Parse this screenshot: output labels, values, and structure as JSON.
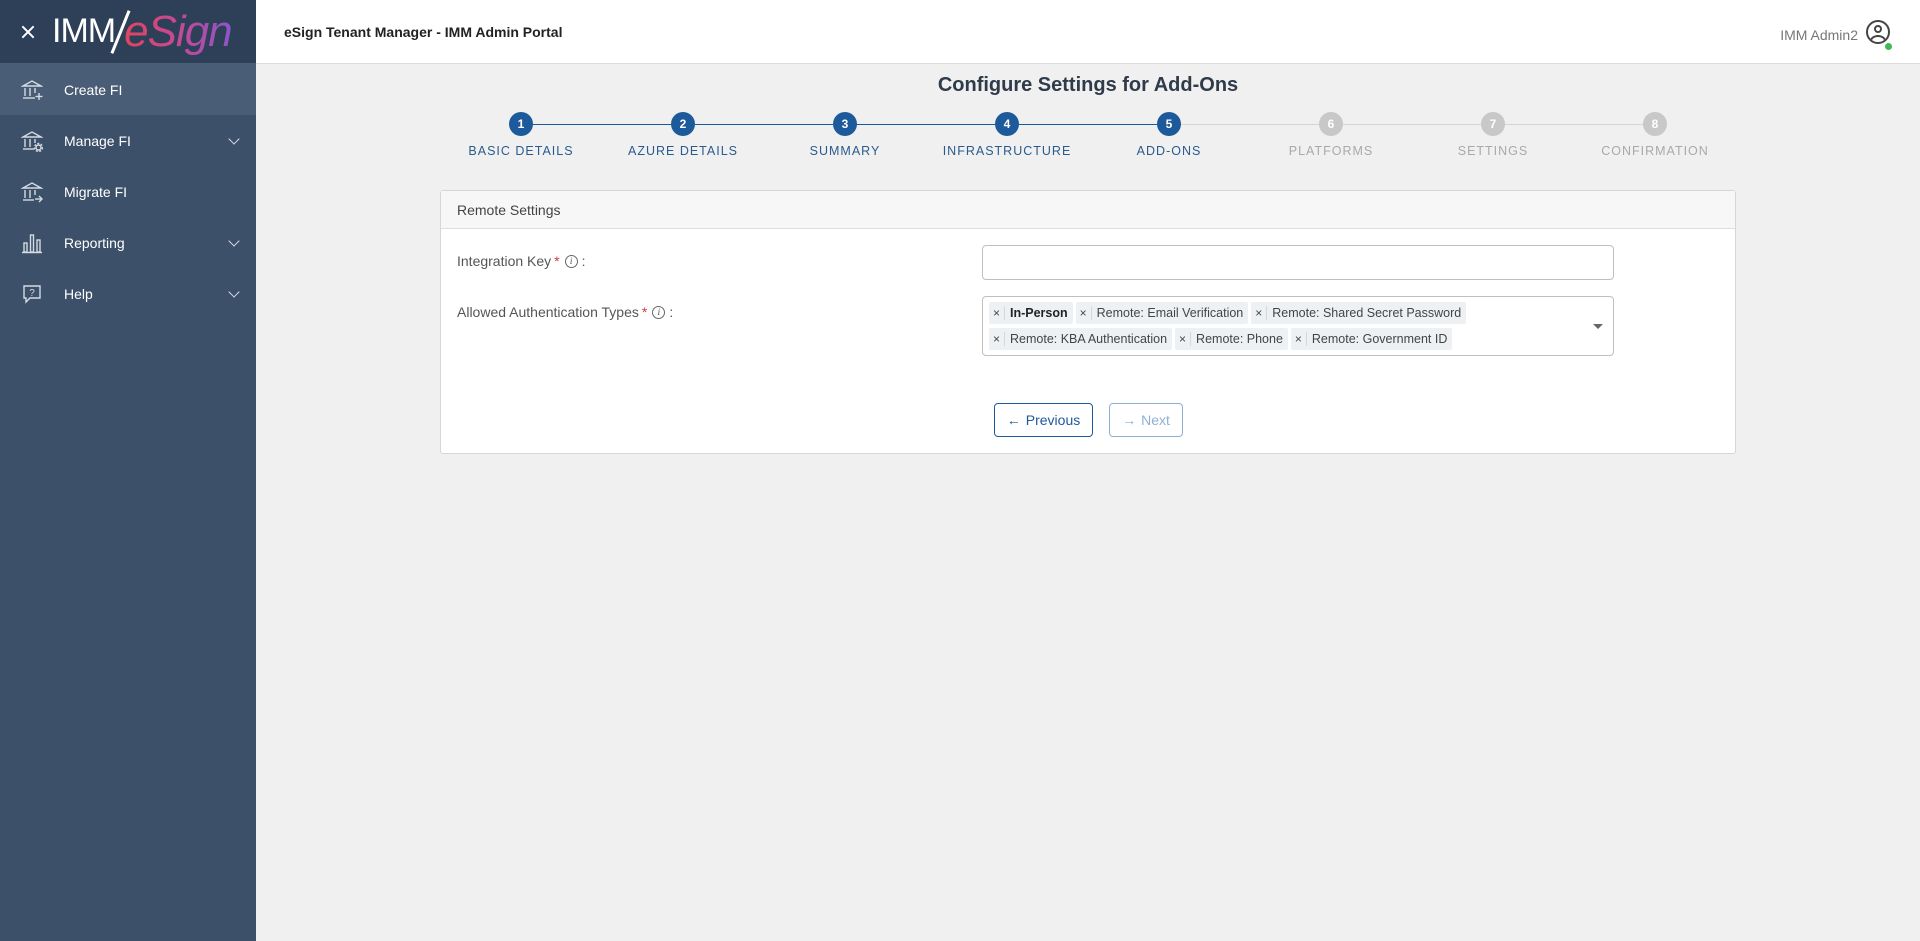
{
  "sidebar": {
    "logo": {
      "imm": "IMM",
      "esign": "eSign"
    },
    "items": [
      {
        "label": "Create FI",
        "icon": "bank-plus-icon",
        "active": true,
        "has_submenu": false
      },
      {
        "label": "Manage FI",
        "icon": "bank-gear-icon",
        "active": false,
        "has_submenu": true
      },
      {
        "label": "Migrate FI",
        "icon": "bank-arrow-icon",
        "active": false,
        "has_submenu": false
      },
      {
        "label": "Reporting",
        "icon": "bar-chart-icon",
        "active": false,
        "has_submenu": true
      },
      {
        "label": "Help",
        "icon": "help-bubble-icon",
        "active": false,
        "has_submenu": true
      }
    ]
  },
  "header": {
    "title": "eSign Tenant Manager - IMM Admin Portal",
    "user_name": "IMM Admin2"
  },
  "page": {
    "title": "Configure Settings for Add-Ons"
  },
  "stepper": {
    "steps": [
      {
        "number": "1",
        "label": "BASIC DETAILS",
        "state": "done"
      },
      {
        "number": "2",
        "label": "AZURE DETAILS",
        "state": "done"
      },
      {
        "number": "3",
        "label": "SUMMARY",
        "state": "done"
      },
      {
        "number": "4",
        "label": "INFRASTRUCTURE",
        "state": "done"
      },
      {
        "number": "5",
        "label": "ADD-ONS",
        "state": "current"
      },
      {
        "number": "6",
        "label": "PLATFORMS",
        "state": "pending"
      },
      {
        "number": "7",
        "label": "SETTINGS",
        "state": "pending"
      },
      {
        "number": "8",
        "label": "CONFIRMATION",
        "state": "pending"
      }
    ]
  },
  "form": {
    "section_title": "Remote Settings",
    "integration_key": {
      "label": "Integration Key",
      "required_mark": "*",
      "colon": ":",
      "value": ""
    },
    "auth_types": {
      "label": "Allowed Authentication Types",
      "required_mark": "*",
      "colon": ":",
      "remove_glyph": "×",
      "selected": [
        {
          "label": "In-Person",
          "emphasized": true
        },
        {
          "label": "Remote: Email Verification",
          "emphasized": false
        },
        {
          "label": "Remote: Shared Secret Password",
          "emphasized": false
        },
        {
          "label": "Remote: KBA Authentication",
          "emphasized": false
        },
        {
          "label": "Remote: Phone",
          "emphasized": false
        },
        {
          "label": "Remote: Government ID",
          "emphasized": false
        }
      ]
    }
  },
  "buttons": {
    "previous": {
      "label": "Previous",
      "arrow": "←"
    },
    "next": {
      "label": "Next",
      "arrow": "→",
      "disabled": true
    }
  },
  "colors": {
    "sidebar_bg": "#3c5069",
    "accent": "#1d5a9b",
    "pending": "#c8c8c8"
  }
}
